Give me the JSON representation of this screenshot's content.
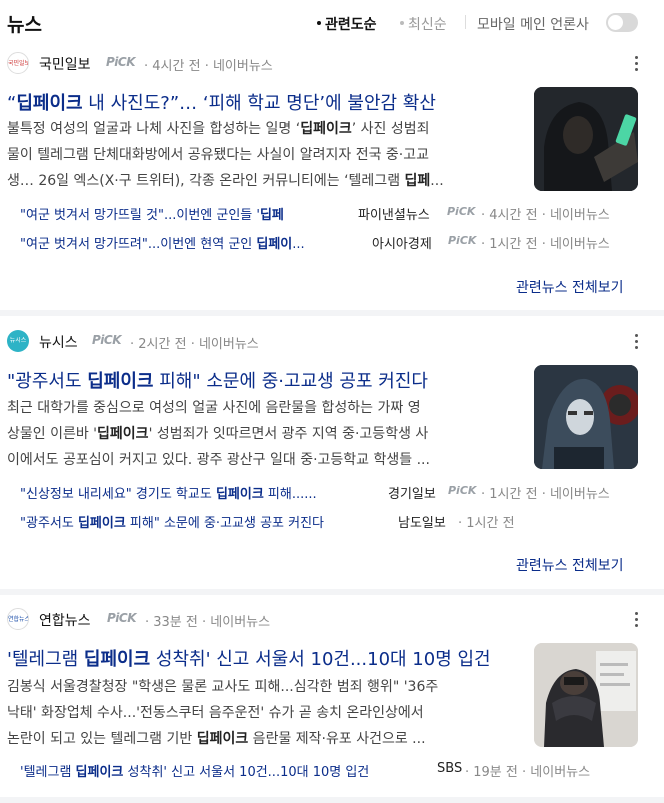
{
  "header": {
    "title": "뉴스",
    "sort_relevance": "관련도순",
    "sort_latest": "최신순",
    "mobile_main_label": "모바일 메인 언론사"
  },
  "cards": [
    {
      "press": "국민일보",
      "logo_text": "국민일보",
      "pick": "PiCK",
      "time": "4시간 전",
      "source": "네이버뉴스",
      "headline_pre": "“",
      "headline_bold": "딥페이크",
      "headline_post": " 내 사진도?”… ‘피해 학교 명단’에 불안감 확산",
      "summary_1a": "불특정 여성의 얼굴과 나체 사진을 합성하는 일명 ‘",
      "summary_1b": "딥페이크",
      "summary_1c": "’ 사진 성범죄",
      "summary_2": "물이 텔레그램 단체대화방에서 공유됐다는 사실이 알려지자 전국 중·고교",
      "summary_3a": "생… 26일 엑스(X·구 트위터), 각종 온라인 커뮤니티에는 ‘텔레그램 ",
      "summary_3b": "딥페",
      "summary_3c": "...",
      "related": [
        {
          "title_pre": "\"여군 벗겨서 망가뜨릴 것\"...이번엔 군인들 '",
          "title_bold": "딥페",
          "title_post": "",
          "press": "파이낸셜뉴스",
          "pick": "PiCK",
          "time": "4시간 전",
          "source": "네이버뉴스"
        },
        {
          "title_pre": "\"여군 벗겨서 망가뜨려\"...이번엔 현역 군인 ",
          "title_bold": "딥페이",
          "title_post": "...",
          "press": "아시아경제",
          "pick": "PiCK",
          "time": "1시간 전",
          "source": "네이버뉴스"
        }
      ],
      "view_all": "관련뉴스 전체보기"
    },
    {
      "press": "뉴시스",
      "logo_text": "뉴시스",
      "pick": "PiCK",
      "time": "2시간 전",
      "source": "네이버뉴스",
      "headline_pre": "\"광주서도 ",
      "headline_bold": "딥페이크",
      "headline_post": " 피해\" 소문에 중·고교생 공포 커진다",
      "summary_1a": "최근 대학가를 중심으로 여성의 얼굴 사진에 음란물을 합성하는 가짜 영",
      "summary_2a": "상물인 이른바 '",
      "summary_2b": "딥페이크",
      "summary_2c": "' 성범죄가 잇따르면서 광주 지역 중·고등학생 사",
      "summary_3": "이에서도 공포심이 커지고 있다. 광주 광산구 일대 중·고등학교 학생들 ...",
      "related": [
        {
          "title_pre": "\"신상정보 내리세요\" 경기도 학교도 ",
          "title_bold": "딥페이크",
          "title_post": " 피해......",
          "press": "경기일보",
          "pick": "PiCK",
          "time": "1시간 전",
          "source": "네이버뉴스"
        },
        {
          "title_pre": "\"광주서도 ",
          "title_bold": "딥페이크",
          "title_post": " 피해\" 소문에 중·고교생 공포 커진다",
          "press": "남도일보",
          "time": "1시간 전"
        }
      ],
      "view_all": "관련뉴스 전체보기"
    },
    {
      "press": "연합뉴스",
      "logo_text": "연합뉴스",
      "pick": "PiCK",
      "time": "33분 전",
      "source": "네이버뉴스",
      "headline_pre": "'텔레그램 ",
      "headline_bold": "딥페이크",
      "headline_post": " 성착취' 신고 서울서 10건...10대 10명 입건",
      "summary_1": "김봉식 서울경찰청장 \"학생은 물론 교사도 피해...심각한 범죄 행위\" '36주",
      "summary_2": "낙태' 화장업체 수사...'전동스쿠터 음주운전' 슈가 곧 송치 온라인상에서",
      "summary_3a": "논란이 되고 있는 텔레그램 기반 ",
      "summary_3b": "딥페이크",
      "summary_3c": " 음란물 제작·유포 사건으로 ...",
      "related": [
        {
          "title_pre": "'텔레그램 ",
          "title_bold": "딥페이크",
          "title_post": " 성착취' 신고 서울서 10건...10대 10명 입건",
          "press": "SBS",
          "time": "19분 전",
          "source": "네이버뉴스"
        }
      ]
    }
  ],
  "colors": {
    "link_blue": "#0b2d8a",
    "meta_gray": "#888888",
    "separator": "#f3f4f6"
  }
}
